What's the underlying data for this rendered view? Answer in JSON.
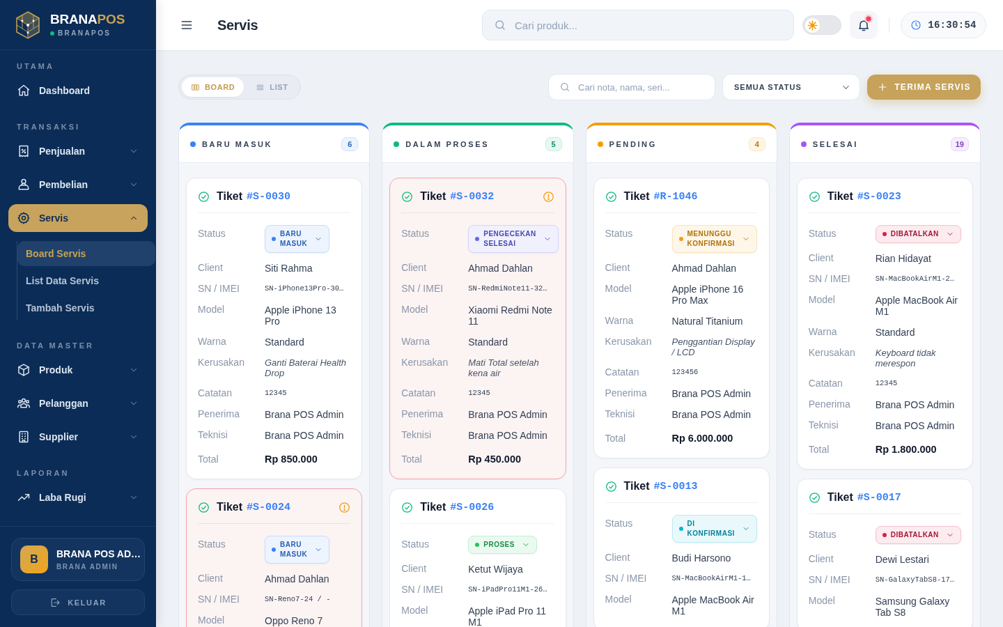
{
  "sidebar": {
    "brand": {
      "name_main": "BRANA",
      "name_accent": "POS",
      "subtitle": "BRANAPOS",
      "online": true
    },
    "sections": [
      {
        "title": "UTAMA",
        "items": [
          {
            "label": "Dashboard",
            "selected": false
          }
        ]
      },
      {
        "title": "TRANSAKSI",
        "items": [
          {
            "label": "Penjualan",
            "selected": false,
            "expanded": false
          },
          {
            "label": "Pembelian",
            "selected": false,
            "expanded": false
          },
          {
            "label": "Servis",
            "selected": true,
            "expanded": true,
            "children": [
              {
                "label": "Board Servis",
                "selected": true
              },
              {
                "label": "List Data Servis",
                "selected": false
              },
              {
                "label": "Tambah Servis",
                "selected": false
              }
            ]
          }
        ]
      },
      {
        "title": "DATA MASTER",
        "items": [
          {
            "label": "Produk",
            "selected": false,
            "expanded": false
          },
          {
            "label": "Pelanggan",
            "selected": false,
            "expanded": false
          },
          {
            "label": "Supplier",
            "selected": false,
            "expanded": false
          }
        ]
      },
      {
        "title": "LAPORAN",
        "items": [
          {
            "label": "Laba Rugi",
            "selected": false,
            "expanded": false
          }
        ]
      }
    ],
    "user": {
      "avatar": "B",
      "name": "BRANA POS AD…",
      "role": "BRANA ADMIN"
    },
    "logout": "KELUAR"
  },
  "header": {
    "title": "Servis",
    "search": {
      "placeholder": "Cari produk..."
    },
    "theme_toggle": {
      "on": false
    },
    "notifications": {
      "unread": true
    },
    "clock": "16:30:54"
  },
  "toolbar": {
    "views": [
      {
        "label": "BOARD",
        "selected": true
      },
      {
        "label": "LIST",
        "selected": false
      }
    ],
    "search": {
      "placeholder": "Cari nota, nama, seri..."
    },
    "status_filter": {
      "value": "SEMUA STATUS"
    },
    "add_button": "TERIMA SERVIS"
  },
  "columns": [
    {
      "title": "BARU MASUK",
      "count": "6",
      "color": "#3b82f6",
      "tickets": [
        {
          "title": "Tiket",
          "id": "#S-0030",
          "warning": false,
          "status": {
            "label": "Status",
            "value": "BARU MASUK",
            "color": "#3b82f6"
          },
          "fields": [
            {
              "label": "Client",
              "value": "Siti Rahma",
              "kind": "text"
            },
            {
              "label": "SN / IMEI",
              "value": "SN-iPhone13Pro-30…",
              "kind": "mono"
            },
            {
              "label": "Model",
              "value": "Apple iPhone 13 Pro",
              "kind": "text"
            },
            {
              "label": "Warna",
              "value": "Standard",
              "kind": "text"
            },
            {
              "label": "Kerusakan",
              "value": "Ganti Baterai Health Drop",
              "kind": "italic"
            },
            {
              "label": "Catatan",
              "value": "12345",
              "kind": "mono"
            },
            {
              "label": "Penerima",
              "value": "Brana POS Admin",
              "kind": "text"
            },
            {
              "label": "Teknisi",
              "value": "Brana POS Admin",
              "kind": "text"
            },
            {
              "label": "Total",
              "value": "Rp 850.000",
              "kind": "total"
            }
          ]
        },
        {
          "title": "Tiket",
          "id": "#S-0024",
          "warning": true,
          "status": {
            "label": "Status",
            "value": "BARU MASUK",
            "color": "#3b82f6"
          },
          "fields": [
            {
              "label": "Client",
              "value": "Ahmad Dahlan",
              "kind": "text"
            },
            {
              "label": "SN / IMEI",
              "value": "SN-Reno7-24 / -",
              "kind": "mono"
            },
            {
              "label": "Model",
              "value": "Oppo Reno 7",
              "kind": "text"
            }
          ]
        }
      ]
    },
    {
      "title": "DALAM PROSES",
      "count": "5",
      "color": "#10b981",
      "tickets": [
        {
          "title": "Tiket",
          "id": "#S-0032",
          "warning": true,
          "status": {
            "label": "Status",
            "value": "PENGECEKAN SELESAI",
            "color": "#6366f1"
          },
          "fields": [
            {
              "label": "Client",
              "value": "Ahmad Dahlan",
              "kind": "text"
            },
            {
              "label": "SN / IMEI",
              "value": "SN-RedmiNote11-32…",
              "kind": "mono"
            },
            {
              "label": "Model",
              "value": "Xiaomi Redmi Note 11",
              "kind": "text"
            },
            {
              "label": "Warna",
              "value": "Standard",
              "kind": "text"
            },
            {
              "label": "Kerusakan",
              "value": "Mati Total setelah kena air",
              "kind": "italic"
            },
            {
              "label": "Catatan",
              "value": "12345",
              "kind": "mono"
            },
            {
              "label": "Penerima",
              "value": "Brana POS Admin",
              "kind": "text"
            },
            {
              "label": "Teknisi",
              "value": "Brana POS Admin",
              "kind": "text"
            },
            {
              "label": "Total",
              "value": "Rp 450.000",
              "kind": "total"
            }
          ]
        },
        {
          "title": "Tiket",
          "id": "#S-0026",
          "warning": false,
          "status": {
            "label": "Status",
            "value": "PROSES",
            "color": "#22c55e"
          },
          "fields": [
            {
              "label": "Client",
              "value": "Ketut Wijaya",
              "kind": "text"
            },
            {
              "label": "SN / IMEI",
              "value": "SN-iPadPro11M1-26…",
              "kind": "mono"
            },
            {
              "label": "Model",
              "value": "Apple iPad Pro 11 M1",
              "kind": "text"
            }
          ]
        }
      ]
    },
    {
      "title": "PENDING",
      "count": "4",
      "color": "#f59e0b",
      "tickets": [
        {
          "title": "Tiket",
          "id": "#R-1046",
          "warning": false,
          "status": {
            "label": "Status",
            "value": "MENUNGGU KONFIRMASI",
            "color": "#f59e0b"
          },
          "fields": [
            {
              "label": "Client",
              "value": "Ahmad Dahlan",
              "kind": "text"
            },
            {
              "label": "Model",
              "value": "Apple iPhone 16 Pro Max",
              "kind": "text"
            },
            {
              "label": "Warna",
              "value": "Natural Titanium",
              "kind": "text"
            },
            {
              "label": "Kerusakan",
              "value": "Penggantian Display / LCD",
              "kind": "italic"
            },
            {
              "label": "Catatan",
              "value": "123456",
              "kind": "mono"
            },
            {
              "label": "Penerima",
              "value": "Brana POS Admin",
              "kind": "text"
            },
            {
              "label": "Teknisi",
              "value": "Brana POS Admin",
              "kind": "text"
            },
            {
              "label": "Total",
              "value": "Rp 6.000.000",
              "kind": "total"
            }
          ]
        },
        {
          "title": "Tiket",
          "id": "#S-0013",
          "warning": false,
          "status": {
            "label": "Status",
            "value": "DI KONFIRMASI",
            "color": "#06b6d4"
          },
          "fields": [
            {
              "label": "Client",
              "value": "Budi Harsono",
              "kind": "text"
            },
            {
              "label": "SN / IMEI",
              "value": "SN-MacBookAirM1-1…",
              "kind": "mono"
            },
            {
              "label": "Model",
              "value": "Apple MacBook Air M1",
              "kind": "text"
            }
          ]
        }
      ]
    },
    {
      "title": "SELESAI",
      "count": "19",
      "color": "#a855f7",
      "tickets": [
        {
          "title": "Tiket",
          "id": "#S-0023",
          "warning": false,
          "status": {
            "label": "Status",
            "value": "DIBATALKAN",
            "color": "#e11d48"
          },
          "fields": [
            {
              "label": "Client",
              "value": "Rian Hidayat",
              "kind": "text"
            },
            {
              "label": "SN / IMEI",
              "value": "SN-MacBookAirM1-2…",
              "kind": "mono"
            },
            {
              "label": "Model",
              "value": "Apple MacBook Air M1",
              "kind": "text"
            },
            {
              "label": "Warna",
              "value": "Standard",
              "kind": "text"
            },
            {
              "label": "Kerusakan",
              "value": "Keyboard tidak merespon",
              "kind": "italic"
            },
            {
              "label": "Catatan",
              "value": "12345",
              "kind": "mono"
            },
            {
              "label": "Penerima",
              "value": "Brana POS Admin",
              "kind": "text"
            },
            {
              "label": "Teknisi",
              "value": "Brana POS Admin",
              "kind": "text"
            },
            {
              "label": "Total",
              "value": "Rp 1.800.000",
              "kind": "total"
            }
          ]
        },
        {
          "title": "Tiket",
          "id": "#S-0017",
          "warning": false,
          "status": {
            "label": "Status",
            "value": "DIBATALKAN",
            "color": "#e11d48"
          },
          "fields": [
            {
              "label": "Client",
              "value": "Dewi Lestari",
              "kind": "text"
            },
            {
              "label": "SN / IMEI",
              "value": "SN-GalaxyTabS8-17…",
              "kind": "mono"
            },
            {
              "label": "Model",
              "value": "Samsung Galaxy Tab S8",
              "kind": "text"
            }
          ]
        }
      ]
    }
  ]
}
